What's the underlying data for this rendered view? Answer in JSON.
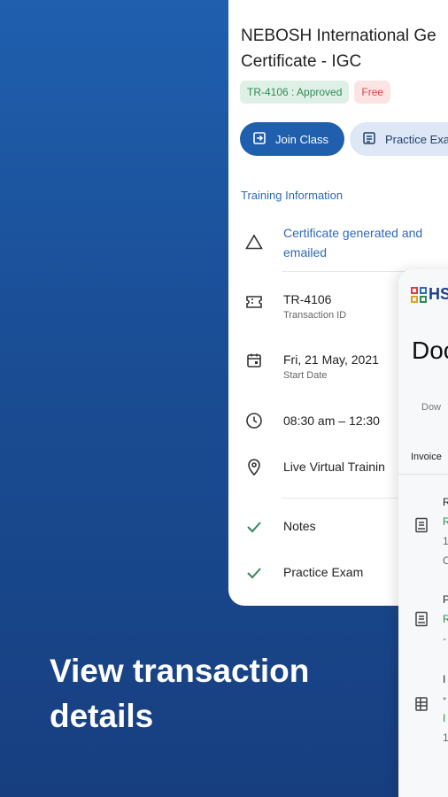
{
  "course": {
    "title_line1": "NEBOSH International Ge",
    "title_line2": "Certificate - IGC",
    "badge_status": "TR-4106 : Approved",
    "badge_price": "Free"
  },
  "actions": {
    "join_class": "Join Class",
    "practice_exam": "Practice Exa"
  },
  "training_info": {
    "section_label": "Training Information",
    "certificate_line1": "Certificate generated and",
    "certificate_line2": "emailed",
    "transaction_id": "TR-4106",
    "transaction_id_label": "Transaction ID",
    "start_date": "Fri, 21 May, 2021",
    "start_date_label": "Start Date",
    "time": "08:30 am – 12:30",
    "location": "Live Virtual Trainin",
    "notes": "Notes",
    "practice_exam": "Practice Exam"
  },
  "doc_panel": {
    "logo": "HS",
    "title": "Doc",
    "sub": "Dow",
    "tab": "Invoice",
    "items": [
      {
        "l1": "R",
        "l2": "R",
        "l3": "1",
        "l4": "C"
      },
      {
        "l1": "P",
        "l2": "R",
        "l3": "-"
      },
      {
        "l1": "I",
        "l2": "•",
        "l3": "I",
        "l4": "1"
      }
    ]
  },
  "caption": {
    "line1": "View transaction",
    "line2": "details"
  },
  "colors": {
    "brand_blue": "#1f5fae",
    "link_blue": "#2f6ab8",
    "approved_green": "#2f8a55",
    "free_red": "#d54848",
    "check_green": "#2f8a55"
  }
}
